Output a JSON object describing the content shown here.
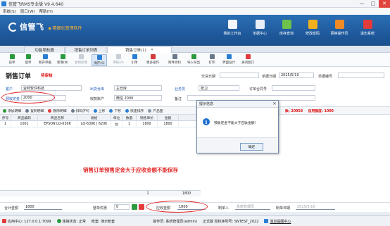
{
  "window": {
    "title": "信管飞RMS专业版 V9.4.640",
    "min": "—",
    "max": "□",
    "close": "✕"
  },
  "menu": [
    "系统(S)",
    "窗口(W)",
    "帮助(H)"
  ],
  "banner": {
    "brand": "信管飞",
    "slogan": "▪ 精细化管理软件",
    "buttons": [
      {
        "label": "我的工作台",
        "color": "#f3f6fb",
        "icon": "monitor-icon"
      },
      {
        "label": "单据中心",
        "color": "#e9eef6",
        "icon": "document-icon"
      },
      {
        "label": "库存查询",
        "color": "#6cc24a",
        "icon": "inventory-icon"
      },
      {
        "label": "修改密码",
        "color": "#f2b01e",
        "icon": "lock-icon"
      },
      {
        "label": "更换操作员",
        "color": "#f08a24",
        "icon": "user-icon"
      },
      {
        "label": "退出系统",
        "color": "#e23b3b",
        "icon": "exit-icon"
      }
    ]
  },
  "tabs": [
    {
      "label": "功能导航器",
      "closable": false
    },
    {
      "label": "销售订单列表",
      "closable": false
    },
    {
      "label": "销售订单(1)",
      "closable": true
    }
  ],
  "toolbar": [
    {
      "label": "前单",
      "color": "#2b9a3e",
      "icon": "prev-icon",
      "disabled": false
    },
    {
      "label": "后单",
      "color": "#2b9a3e",
      "icon": "next-icon",
      "disabled": false
    },
    {
      "label": "新开单据",
      "color": "#2a7fd4",
      "icon": "new-doc-icon",
      "disabled": false
    },
    {
      "label": "新增(N)",
      "color": "#2b9a3e",
      "icon": "add-icon",
      "disabled": false
    },
    {
      "label": "复制新增",
      "color": "#8a97a8",
      "icon": "copy-icon",
      "disabled": true
    },
    {
      "label": "保存(S)",
      "color": "#2a7fd4",
      "icon": "save-icon",
      "disabled": false
    },
    {
      "label": "审核(A)",
      "color": "#8a97a8",
      "icon": "audit-icon",
      "disabled": true
    },
    {
      "label": "引单",
      "color": "#2a7fd4",
      "icon": "import-order-icon",
      "disabled": false
    },
    {
      "label": "更多操作",
      "color": "#d63b3b",
      "icon": "more-icon",
      "disabled": false
    },
    {
      "label": "附件资料",
      "color": "#6a7a8c",
      "icon": "attachment-icon",
      "disabled": false
    },
    {
      "label": "导入导出",
      "color": "#2b9a3e",
      "icon": "import-export-icon",
      "disabled": false
    },
    {
      "label": "打印",
      "color": "#6a7a8c",
      "icon": "print-icon",
      "disabled": false
    },
    {
      "label": "界面设计",
      "color": "#2a7fd4",
      "icon": "design-icon",
      "disabled": false
    },
    {
      "label": "关闭窗口",
      "color": "#e23b3b",
      "icon": "close-window-icon",
      "disabled": false
    }
  ],
  "order": {
    "title": "销售订单",
    "status": "待审核",
    "doc_no_label": "交货日期",
    "date_label": "单据日期",
    "date_value": "2025/5/10",
    "doc_no_field_label": "单据编号",
    "customer_label": "客户",
    "customer_value": "亚邦软件科技",
    "warehouse_label": "出货仓库",
    "warehouse_value": "主仓库",
    "salesman_label": "业务员",
    "salesman_value": "张卫",
    "order_ref_label": "订单合同号",
    "deposit_label": "预收定金",
    "deposit_value": "2000",
    "account_label": "收款账户",
    "account_value": "微信 2000",
    "remark_label": "备注"
  },
  "gridbar": {
    "buttons": [
      {
        "label": "添加明细",
        "color": "#2b9a3e",
        "icon": "add-row-icon"
      },
      {
        "label": "复制明细",
        "color": "#6a7a8c",
        "icon": "copy-row-icon"
      },
      {
        "label": "删除明细",
        "color": "#e23b3b",
        "icon": "delete-row-icon"
      },
      {
        "label": "扫码(F4)",
        "color": "#6a7a8c",
        "icon": "scan-icon"
      },
      {
        "label": "上移",
        "color": "#2a7fd4",
        "icon": "up-icon"
      },
      {
        "label": "下移",
        "color": "#2a7fd4",
        "icon": "down-icon"
      },
      {
        "label": "快速排序",
        "color": "#2a7fd4",
        "icon": "sort-icon"
      },
      {
        "label": "产品图",
        "color": "#8a97a8",
        "icon": "image-icon"
      }
    ],
    "credit_text": "款: 20058",
    "credit_limit": "信用额度: 1000"
  },
  "grid": {
    "columns": [
      "序号",
      "商品编码",
      "商品名称",
      "规格",
      "单位",
      "数量",
      "销售单价",
      "金额"
    ],
    "rows": [
      [
        "1",
        "1001",
        "EPSON LQ-630K",
        "LQ-630K | 620K",
        "台",
        "1",
        "1800",
        "1800"
      ]
    ],
    "footer_qty": "1",
    "footer_amount": "1800"
  },
  "annotation": "销售订单预售定金大于应收金额不能保存",
  "dialog": {
    "title": "提示信息",
    "close": "✕",
    "icon": "i",
    "message": "预收定金不能大于应收金额！",
    "ok": "确定"
  },
  "totals": {
    "total_label": "合计金额",
    "total_value": "1800",
    "discount_label": "整单优惠",
    "discount_value": "0",
    "receivable_label": "应收金额",
    "receivable_value": "1800",
    "creator_label": "制单人",
    "creator_value": "系统管理员",
    "create_date_label": "制单日期",
    "create_date_value": "2025/5/10"
  },
  "status": {
    "center": "应用中心: 127.0.0.1:7099",
    "conn": "连接状态: 正常",
    "account": "帐套: 演示帐套",
    "operator": "操作员: 系统管理员(admin)",
    "edition": "正式版 授权序列号: SNTEST_2022",
    "msg": "消息提醒中心"
  }
}
